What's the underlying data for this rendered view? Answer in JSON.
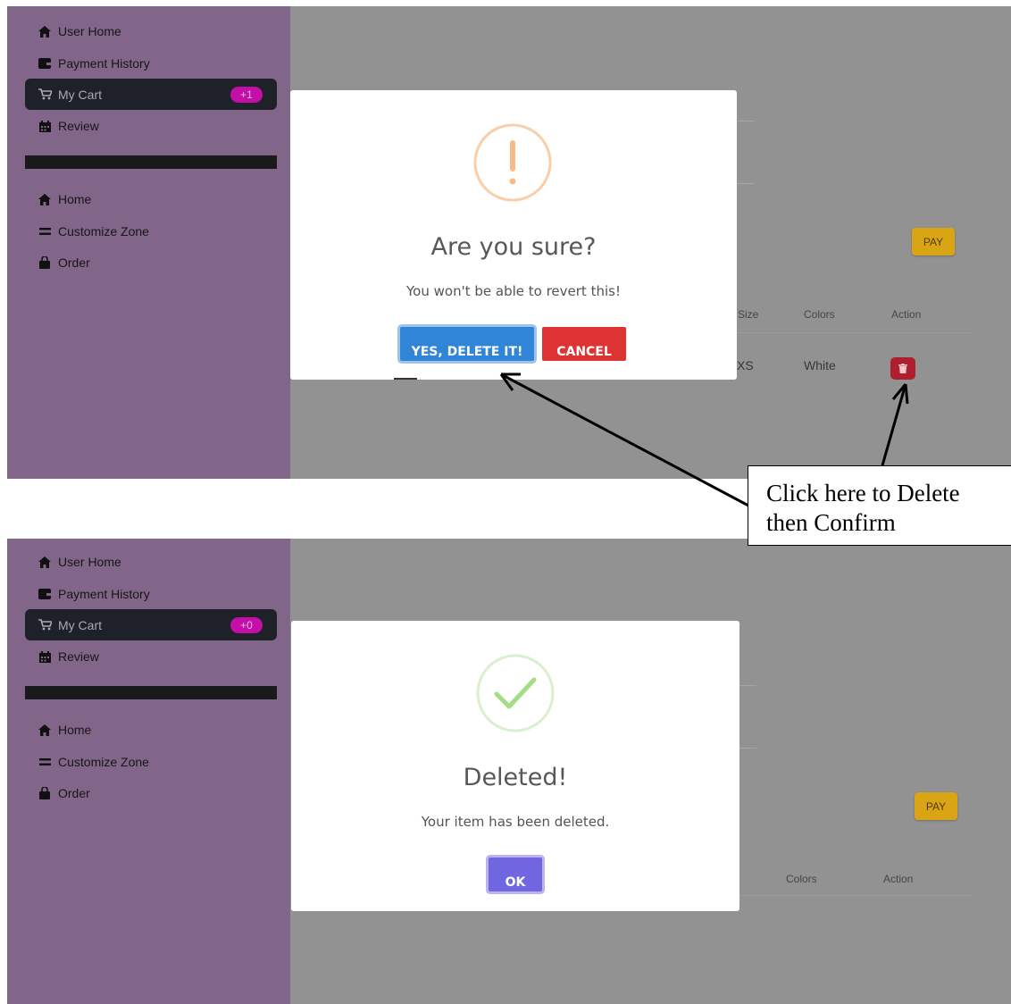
{
  "screens": [
    {
      "sidebar": {
        "items": [
          {
            "label": "User Home",
            "icon": "home-icon"
          },
          {
            "label": "Payment History",
            "icon": "wallet-icon"
          },
          {
            "label": "My Cart",
            "icon": "cart-icon",
            "badge": "+1",
            "active": true
          },
          {
            "label": "Review",
            "icon": "calendar-icon"
          }
        ],
        "secondary_items": [
          {
            "label": "Home",
            "icon": "home-icon"
          },
          {
            "label": "Customize Zone",
            "icon": "equals-icon"
          },
          {
            "label": "Order",
            "icon": "bag-icon"
          }
        ]
      },
      "main": {
        "pay_label": "PAY",
        "columns": [
          "Size",
          "Colors",
          "Action"
        ],
        "row": {
          "size": "XS",
          "color": "White"
        }
      },
      "modal": {
        "icon": "warning-icon",
        "title": "Are you sure?",
        "text": "You won't be able to revert this!",
        "confirm_label": "YES, DELETE IT!",
        "cancel_label": "CANCEL"
      }
    },
    {
      "sidebar": {
        "items": [
          {
            "label": "User Home",
            "icon": "home-icon"
          },
          {
            "label": "Payment History",
            "icon": "wallet-icon"
          },
          {
            "label": "My Cart",
            "icon": "cart-icon",
            "badge": "+0",
            "active": true
          },
          {
            "label": "Review",
            "icon": "calendar-icon"
          }
        ],
        "secondary_items": [
          {
            "label": "Home",
            "icon": "home-icon"
          },
          {
            "label": "Customize Zone",
            "icon": "equals-icon"
          },
          {
            "label": "Order",
            "icon": "bag-icon"
          }
        ]
      },
      "main": {
        "pay_label": "PAY",
        "columns": [
          "Colors",
          "Action"
        ]
      },
      "modal": {
        "icon": "success-check-icon",
        "title": "Deleted!",
        "text": "Your item has been deleted.",
        "ok_label": "OK"
      }
    }
  ],
  "annotation": {
    "text_line1": "Click here to Delete",
    "text_line2": "then Confirm"
  },
  "colors": {
    "sidebar_bg": "#82668a",
    "overlay_bg": "#929292",
    "badge": "#c40ea8",
    "confirm_button": "#3085d6",
    "cancel_button": "#dd3333",
    "ok_button": "#7066e0",
    "pay_button": "#d9a514",
    "delete_button": "#ad1f2c"
  }
}
